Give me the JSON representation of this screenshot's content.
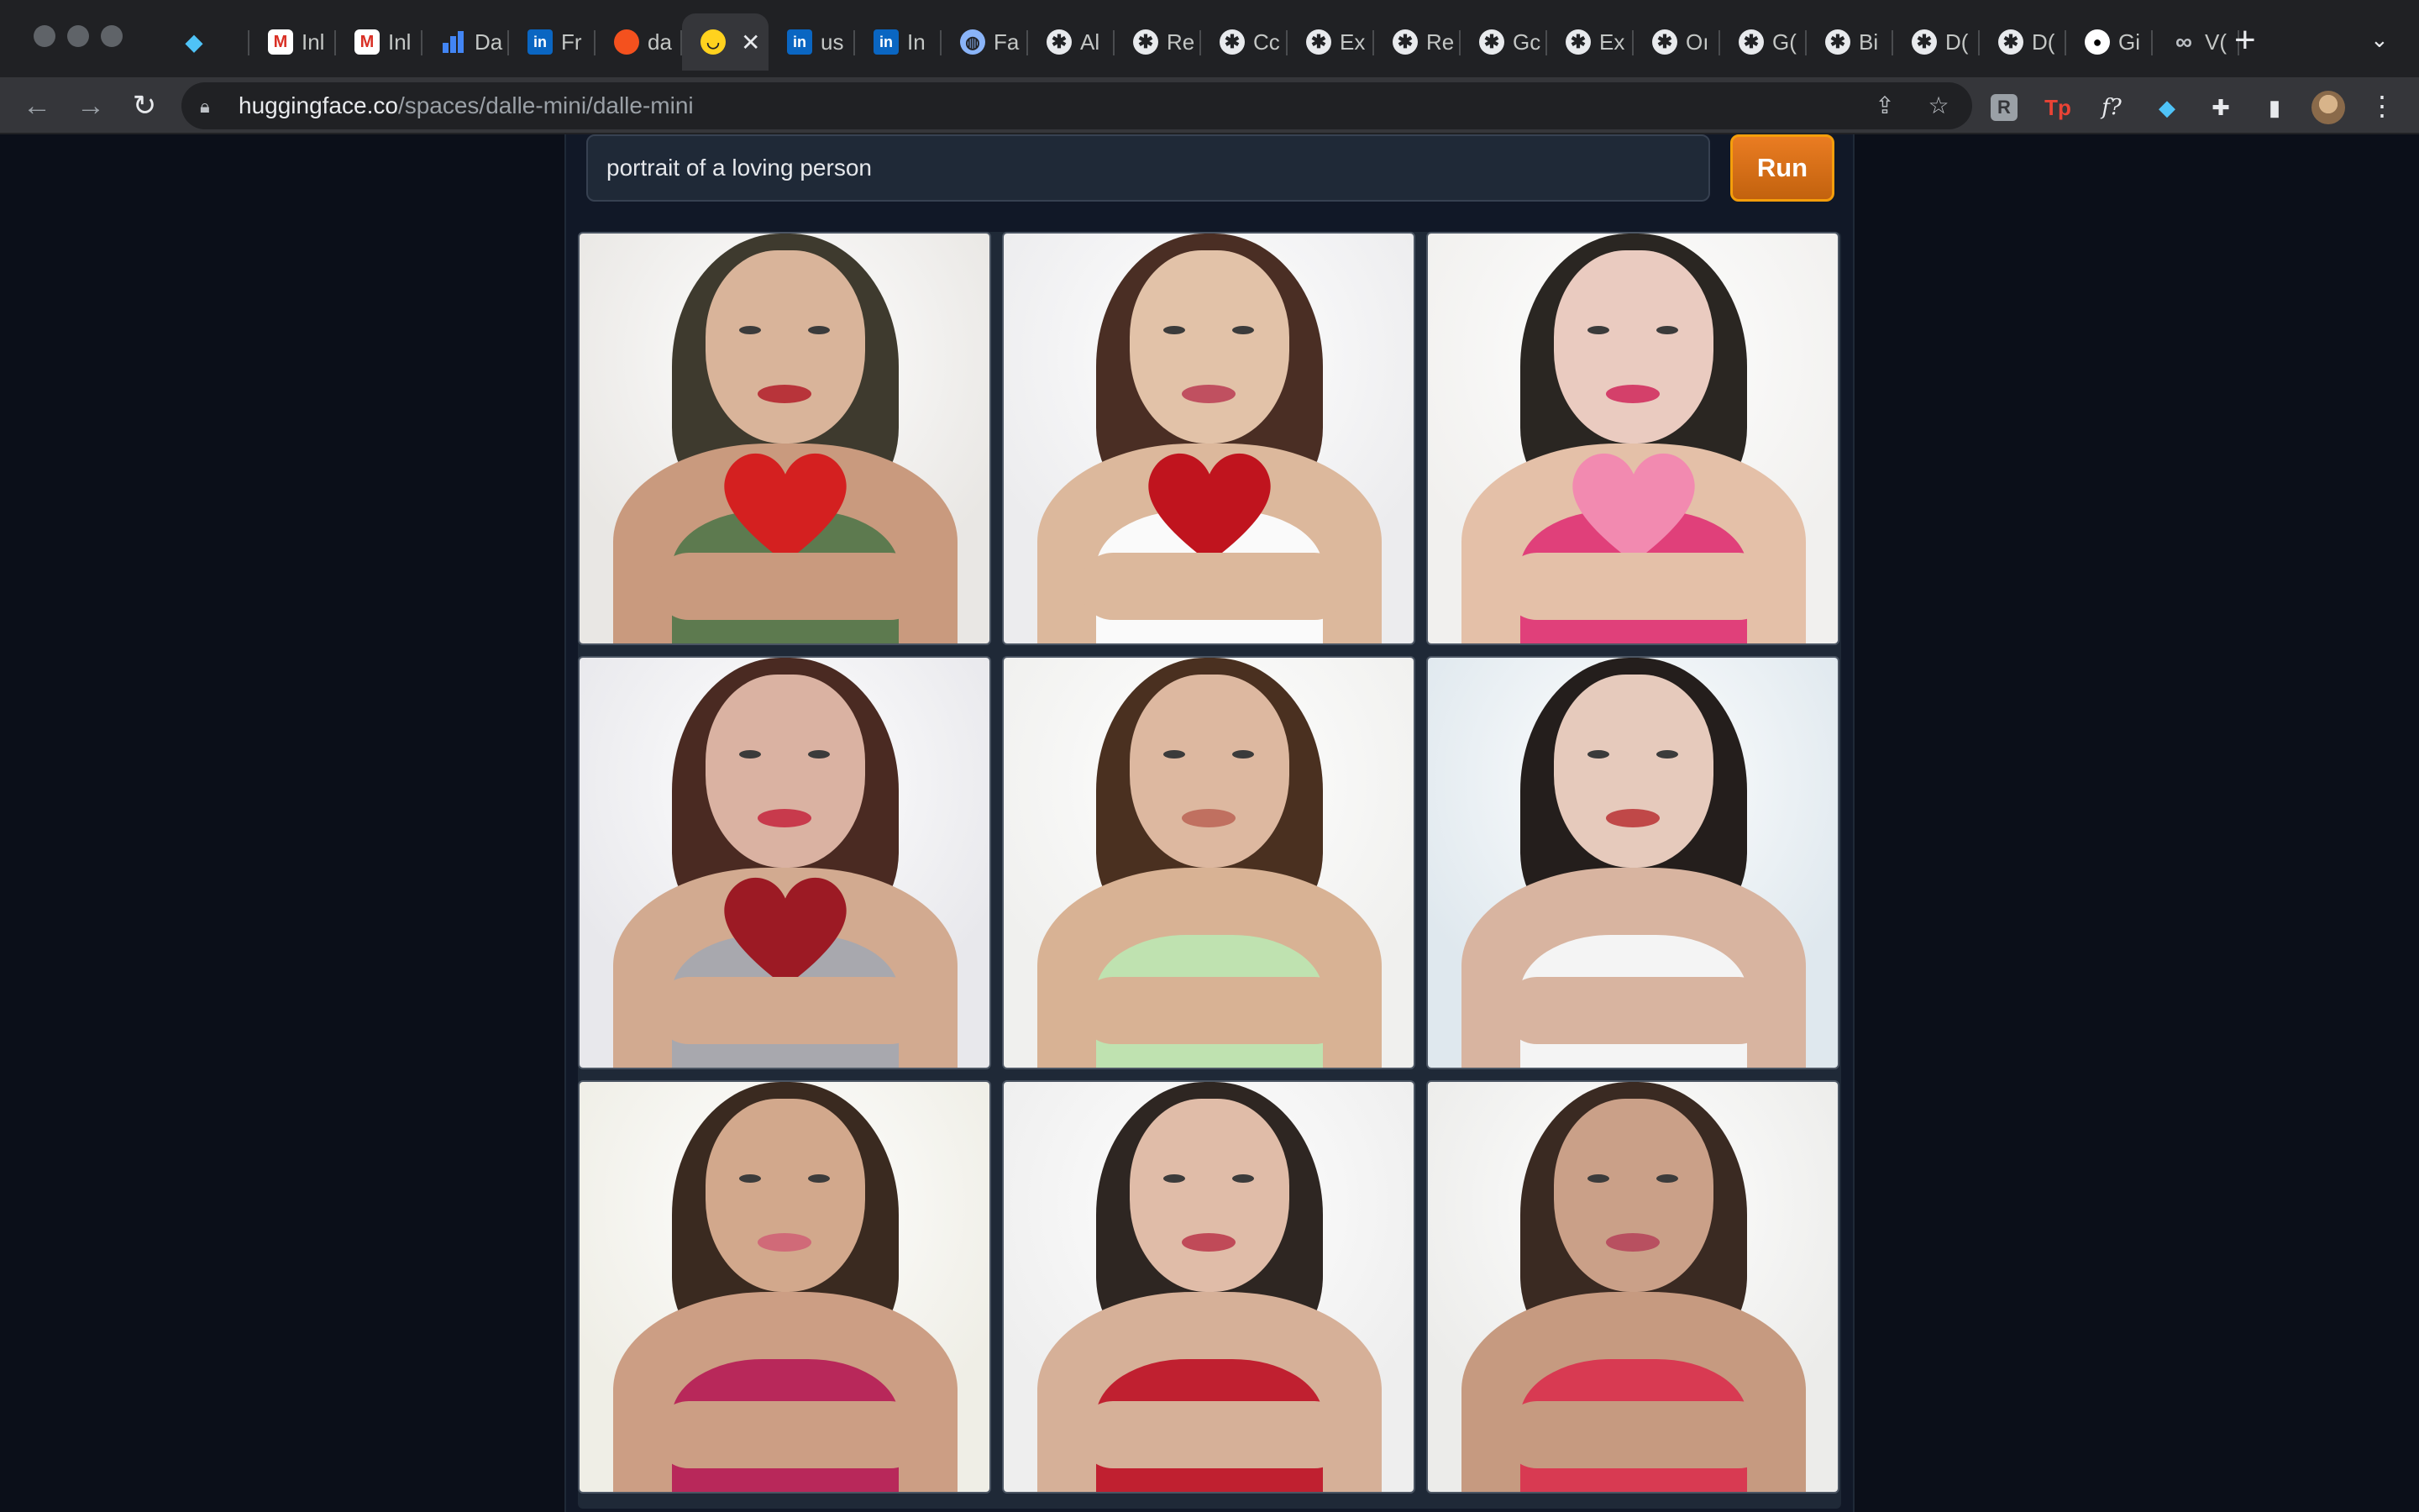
{
  "browser": {
    "tabs": [
      {
        "icon": "gem-icon",
        "title": ""
      },
      {
        "icon": "gmail-icon",
        "title": "Inl"
      },
      {
        "icon": "gmail-icon",
        "title": "Inl"
      },
      {
        "icon": "analytics-icon",
        "title": "Da"
      },
      {
        "icon": "linkedin-icon",
        "title": "Fr"
      },
      {
        "icon": "duckduckgo-icon",
        "title": "da"
      },
      {
        "icon": "huggingface-icon",
        "title": "",
        "active": true
      },
      {
        "icon": "linkedin-icon",
        "title": "us"
      },
      {
        "icon": "linkedin-icon",
        "title": "In"
      },
      {
        "icon": "globe-icon",
        "title": "Fa"
      },
      {
        "icon": "gear-icon",
        "title": "Al"
      },
      {
        "icon": "gear-icon",
        "title": "Re"
      },
      {
        "icon": "gear-icon",
        "title": "Cc"
      },
      {
        "icon": "gear-icon",
        "title": "Ex"
      },
      {
        "icon": "gear-icon",
        "title": "Re"
      },
      {
        "icon": "gear-icon",
        "title": "Gc"
      },
      {
        "icon": "gear-icon",
        "title": "Ex"
      },
      {
        "icon": "gear-icon",
        "title": "Oı"
      },
      {
        "icon": "gear-icon",
        "title": "G("
      },
      {
        "icon": "gear-icon",
        "title": "Bi"
      },
      {
        "icon": "gear-icon",
        "title": "D("
      },
      {
        "icon": "gear-icon",
        "title": "D("
      },
      {
        "icon": "github-icon",
        "title": "Gi"
      },
      {
        "icon": "infinity-icon",
        "title": "V("
      }
    ],
    "url_host": "huggingface.co",
    "url_path": "/spaces/dalle-mini/dalle-mini"
  },
  "app": {
    "prompt_value": "portrait of a loving person",
    "run_label": "Run"
  },
  "gallery": {
    "images": [
      {
        "alt": "portrait-1"
      },
      {
        "alt": "portrait-2"
      },
      {
        "alt": "portrait-3"
      },
      {
        "alt": "portrait-4"
      },
      {
        "alt": "portrait-5"
      },
      {
        "alt": "portrait-6"
      },
      {
        "alt": "portrait-7"
      },
      {
        "alt": "portrait-8"
      },
      {
        "alt": "portrait-9"
      }
    ]
  },
  "colors": {
    "page_bg": "#0b0f19",
    "panel_bg": "#111827",
    "run_button": "#d97706"
  }
}
